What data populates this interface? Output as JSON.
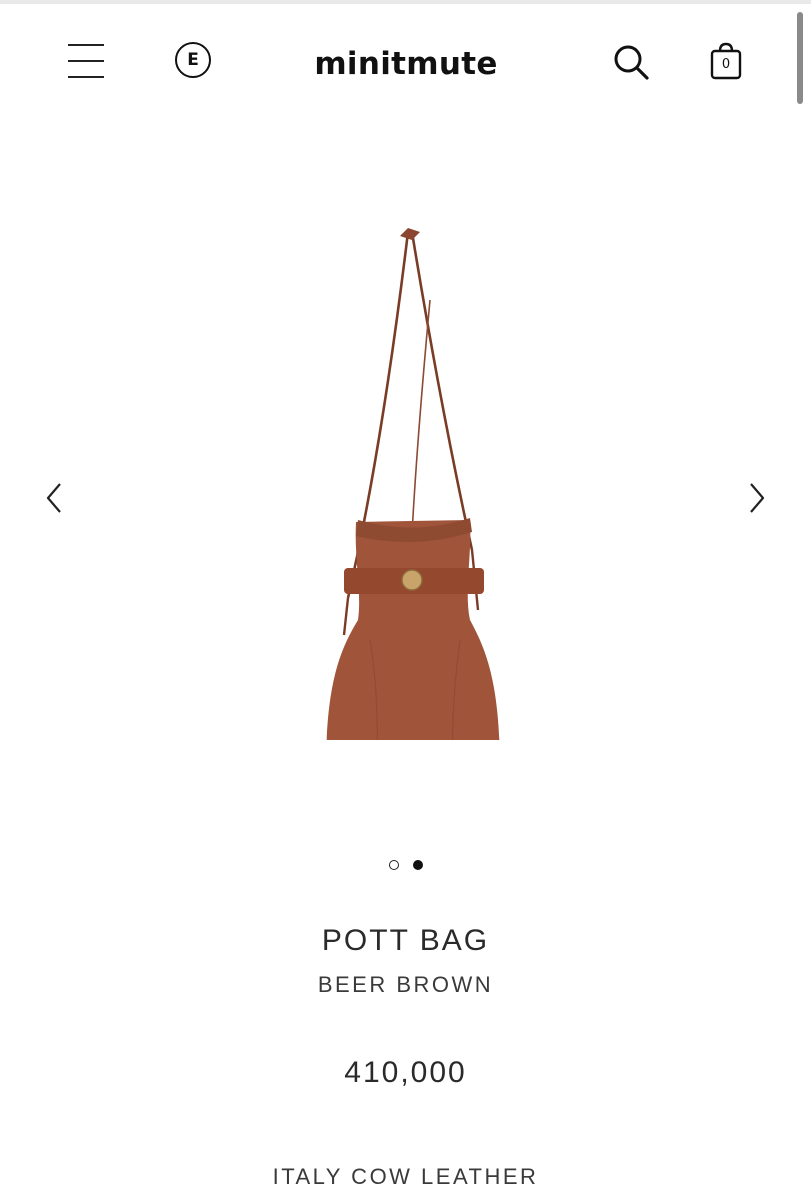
{
  "header": {
    "logo": "minitmute",
    "badge_letter": "E",
    "cart_count": "0",
    "icons": [
      "menu-icon",
      "search-icon",
      "shopping-bag-icon"
    ]
  },
  "gallery": {
    "prev_icon": "chevron-left-icon",
    "next_icon": "chevron-right-icon",
    "total_images": 2,
    "active_index": 2,
    "bag_color": "#a0543a"
  },
  "product": {
    "name": "POTT BAG",
    "color": "BEER BROWN",
    "price": "410,000",
    "material": "ITALY COW LEATHER"
  }
}
